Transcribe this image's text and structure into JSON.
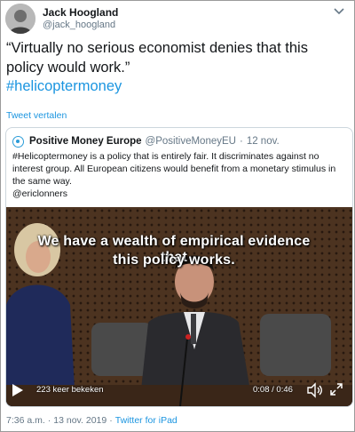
{
  "author": {
    "name": "Jack Hoogland",
    "handle": "@jack_hoogland"
  },
  "tweet": {
    "text": "“Virtually no serious economist denies that this policy would work.”",
    "hashtag": "#helicoptermoney",
    "translate_label": "Tweet vertalen"
  },
  "quoted": {
    "name": "Positive Money Europe",
    "handle": "@PositiveMoneyEU",
    "separator": "·",
    "date": "12 nov.",
    "text": "#Helicoptermoney is a policy that is entirely fair. It discriminates against no interest group. All European citizens would benefit from a monetary stimulus in the same way.",
    "mention": "@ericlonners"
  },
  "video": {
    "subtitle_line1": "We have a wealth of empirical evidence that",
    "subtitle_line2": "this policy works.",
    "views": "223 keer bekeken",
    "time": "0:08 / 0:46"
  },
  "footer": {
    "time": "7:36 a.m.",
    "separator": "·",
    "date": "13 nov. 2019",
    "source": "Twitter for iPad"
  },
  "colors": {
    "link": "#1b95e0",
    "muted": "#657786",
    "border": "#ccd6dd"
  },
  "icons": [
    "chevron-down-icon",
    "play-icon",
    "volume-icon",
    "fullscreen-icon",
    "quote-avatar-icon"
  ]
}
